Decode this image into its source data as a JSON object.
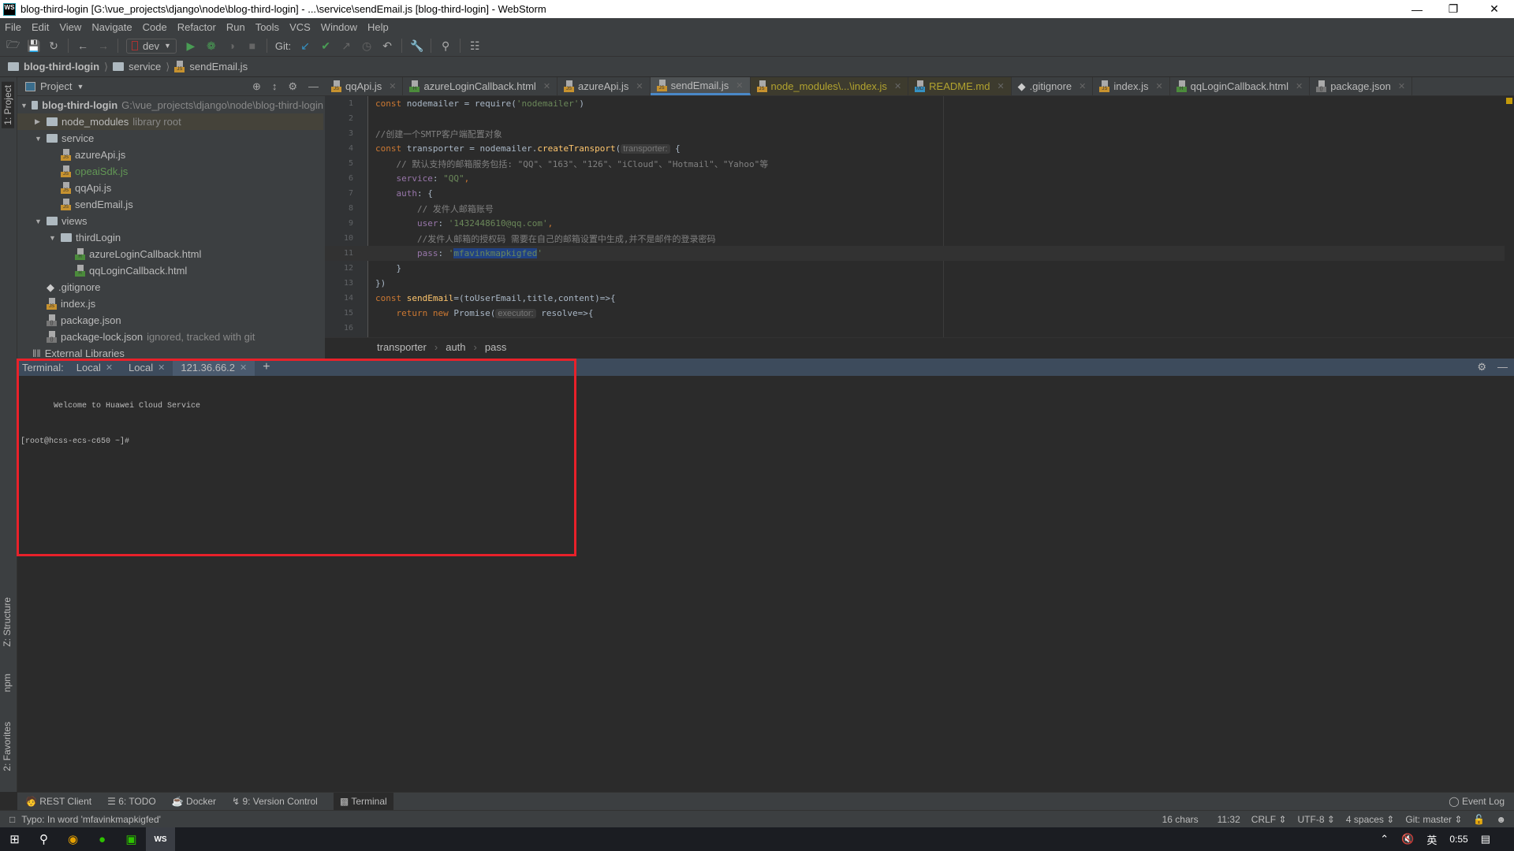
{
  "window": {
    "title": "blog-third-login [G:\\vue_projects\\django\\node\\blog-third-login] - ...\\service\\sendEmail.js [blog-third-login] - WebStorm",
    "app_badge": "WS"
  },
  "menu": [
    "File",
    "Edit",
    "View",
    "Navigate",
    "Code",
    "Refactor",
    "Run",
    "Tools",
    "VCS",
    "Window",
    "Help"
  ],
  "toolbar": {
    "run_config": "dev",
    "git_label": "Git:"
  },
  "breadcrumb": [
    "blog-third-login",
    "service",
    "sendEmail.js"
  ],
  "left_strip": {
    "project": "1: Project",
    "structure": "Z: Structure",
    "npm": "npm",
    "favorites": "2: Favorites"
  },
  "project": {
    "title": "Project",
    "tree": [
      {
        "label": "blog-third-login",
        "hint": "G:\\vue_projects\\django\\node\\blog-third-login",
        "type": "folder",
        "depth": 0,
        "open": true,
        "bold": true
      },
      {
        "label": "node_modules",
        "hint": "library root",
        "type": "folder",
        "depth": 1,
        "open": false
      },
      {
        "label": "service",
        "type": "folder",
        "depth": 1,
        "open": true
      },
      {
        "label": "azureApi.js",
        "type": "js",
        "depth": 2
      },
      {
        "label": "opeaiSdk.js",
        "type": "js",
        "depth": 2,
        "color": "#629755"
      },
      {
        "label": "qqApi.js",
        "type": "js",
        "depth": 2
      },
      {
        "label": "sendEmail.js",
        "type": "js",
        "depth": 2
      },
      {
        "label": "views",
        "type": "folder",
        "depth": 1,
        "open": true
      },
      {
        "label": "thirdLogin",
        "type": "folder",
        "depth": 2,
        "open": true
      },
      {
        "label": "azureLoginCallback.html",
        "type": "html",
        "depth": 3
      },
      {
        "label": "qqLoginCallback.html",
        "type": "html",
        "depth": 3
      },
      {
        "label": ".gitignore",
        "type": "git",
        "depth": 1
      },
      {
        "label": "index.js",
        "type": "js",
        "depth": 1
      },
      {
        "label": "package.json",
        "type": "json",
        "depth": 1
      },
      {
        "label": "package-lock.json",
        "hint": "ignored, tracked with git",
        "type": "json",
        "depth": 1
      },
      {
        "label": "External Libraries",
        "type": "lib",
        "depth": 0
      }
    ]
  },
  "tabs": [
    {
      "label": "qqApi.js",
      "type": "js"
    },
    {
      "label": "azureLoginCallback.html",
      "type": "html"
    },
    {
      "label": "azureApi.js",
      "type": "js"
    },
    {
      "label": "sendEmail.js",
      "type": "js",
      "active": true
    },
    {
      "label": "node_modules\\...\\index.js",
      "type": "js",
      "yellow": true
    },
    {
      "label": "README.md",
      "type": "md",
      "yellow": true
    },
    {
      "label": ".gitignore",
      "type": "git"
    },
    {
      "label": "index.js",
      "type": "js"
    },
    {
      "label": "qqLoginCallback.html",
      "type": "html"
    },
    {
      "label": "package.json",
      "type": "json"
    }
  ],
  "code": {
    "current_line": 11,
    "lines": [
      [
        [
          "const ",
          "k"
        ],
        [
          "nodemailer",
          "t"
        ],
        [
          " = ",
          "t"
        ],
        [
          "require",
          "t"
        ],
        [
          "(",
          "t"
        ],
        [
          "'nodemailer'",
          "s"
        ],
        [
          ")",
          "t"
        ]
      ],
      [],
      [
        [
          "//创建一个SMTP客户端配置对象",
          "c"
        ]
      ],
      [
        [
          "const ",
          "k"
        ],
        [
          "transporter = nodemailer.",
          "t"
        ],
        [
          "createTransport",
          "f"
        ],
        [
          "(",
          "t"
        ],
        [
          "transporter:",
          "ih"
        ],
        [
          " {",
          "t"
        ]
      ],
      [
        [
          "    // 默认支持的邮箱服务包括: \"QQ\"、\"163\"、\"126\"、\"iCloud\"、\"Hotmail\"、\"Yahoo\"等",
          "c"
        ]
      ],
      [
        [
          "    service",
          "p"
        ],
        [
          ": ",
          "t"
        ],
        [
          "\"QQ\"",
          "s"
        ],
        [
          ",",
          "k"
        ]
      ],
      [
        [
          "    auth",
          "p"
        ],
        [
          ": {",
          "t"
        ]
      ],
      [
        [
          "        // 发件人邮箱账号",
          "c"
        ]
      ],
      [
        [
          "        user",
          "p"
        ],
        [
          ": ",
          "t"
        ],
        [
          "'1432448610@qq.com'",
          "s"
        ],
        [
          ",",
          "k"
        ]
      ],
      [
        [
          "        //发件人邮箱的授权码 需要在自己的邮箱设置中生成,并不是邮件的登录密码",
          "c"
        ]
      ],
      [
        [
          "        pass",
          "p"
        ],
        [
          ": ",
          "t"
        ],
        [
          "'",
          "s"
        ],
        [
          "mfavinkmapkigfed",
          "s hl"
        ],
        [
          "'",
          "s"
        ]
      ],
      [
        [
          "    }",
          "t"
        ]
      ],
      [
        [
          "})",
          "t"
        ]
      ],
      [
        [
          "const ",
          "k"
        ],
        [
          "sendEmail",
          "f"
        ],
        [
          "=(toUserEmail,title,content)=>{",
          "t"
        ]
      ],
      [
        [
          "    return ",
          "k"
        ],
        [
          "new ",
          "k"
        ],
        [
          "Promise",
          "t"
        ],
        [
          "(",
          "t"
        ],
        [
          "executor:",
          "ih"
        ],
        [
          " resolve=>{",
          "t"
        ]
      ],
      []
    ]
  },
  "editor_breadcrumb": [
    "transporter",
    "auth",
    "pass"
  ],
  "terminal": {
    "label": "Terminal:",
    "tabs": [
      {
        "label": "Local"
      },
      {
        "label": "Local"
      },
      {
        "label": "121.36.66.2",
        "active": true
      }
    ],
    "lines": [
      "",
      "       Welcome to Huawei Cloud Service",
      "",
      "",
      "[root@hcss-ecs-c650 ~]#"
    ]
  },
  "bottom_tools": [
    "REST Client",
    "6: TODO",
    "Docker",
    "9: Version Control",
    "Terminal",
    "Event Log"
  ],
  "status": {
    "message": "Typo: In word 'mfavinkmapkigfed'",
    "chars": "16 chars",
    "position": "11:32",
    "line_sep": "CRLF",
    "encoding": "UTF-8",
    "indent": "4 spaces",
    "git": "Git: master"
  },
  "taskbar": {
    "time": "0:55",
    "ime": "英"
  },
  "colors": {
    "highlight_box": "#e8212a",
    "accent": "#4a88c7"
  }
}
